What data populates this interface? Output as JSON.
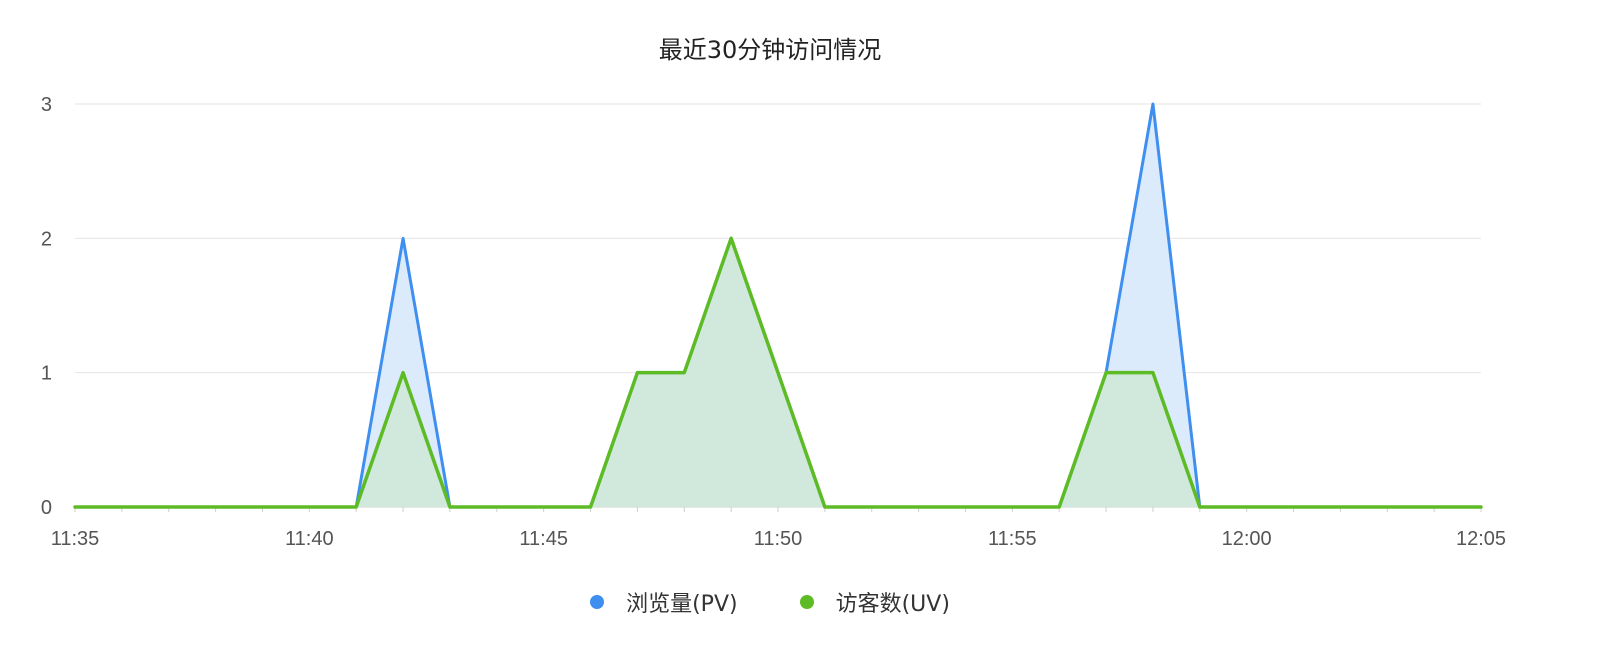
{
  "chart_data": {
    "type": "area",
    "title": "最近30分钟访问情况",
    "x": [
      "11:35",
      "11:36",
      "11:37",
      "11:38",
      "11:39",
      "11:40",
      "11:41",
      "11:42",
      "11:43",
      "11:44",
      "11:45",
      "11:46",
      "11:47",
      "11:48",
      "11:49",
      "11:50",
      "11:51",
      "11:52",
      "11:53",
      "11:54",
      "11:55",
      "11:56",
      "11:57",
      "11:58",
      "11:59",
      "12:00",
      "12:01",
      "12:02",
      "12:03",
      "12:04",
      "12:05"
    ],
    "x_tick_labels": [
      "11:35",
      "11:40",
      "11:45",
      "11:50",
      "11:55",
      "12:00",
      "12:05"
    ],
    "y_tick_labels": [
      "0",
      "1",
      "2",
      "3"
    ],
    "ylim": [
      0,
      3
    ],
    "grid": true,
    "legend_position": "bottom",
    "series": [
      {
        "name": "浏览量(PV)",
        "color": "#3f8ff0",
        "fill": "#dcebfb",
        "values": [
          0,
          0,
          0,
          0,
          0,
          0,
          0,
          2,
          0,
          0,
          0,
          0,
          1,
          1,
          2,
          1,
          0,
          0,
          0,
          0,
          0,
          0,
          1,
          3,
          0,
          0,
          0,
          0,
          0,
          0,
          0
        ]
      },
      {
        "name": "访客数(UV)",
        "color": "#5dbb26",
        "fill": "#cfe9d9",
        "values": [
          0,
          0,
          0,
          0,
          0,
          0,
          0,
          1,
          0,
          0,
          0,
          0,
          1,
          1,
          2,
          1,
          0,
          0,
          0,
          0,
          0,
          0,
          1,
          1,
          0,
          0,
          0,
          0,
          0,
          0,
          0
        ]
      }
    ]
  }
}
